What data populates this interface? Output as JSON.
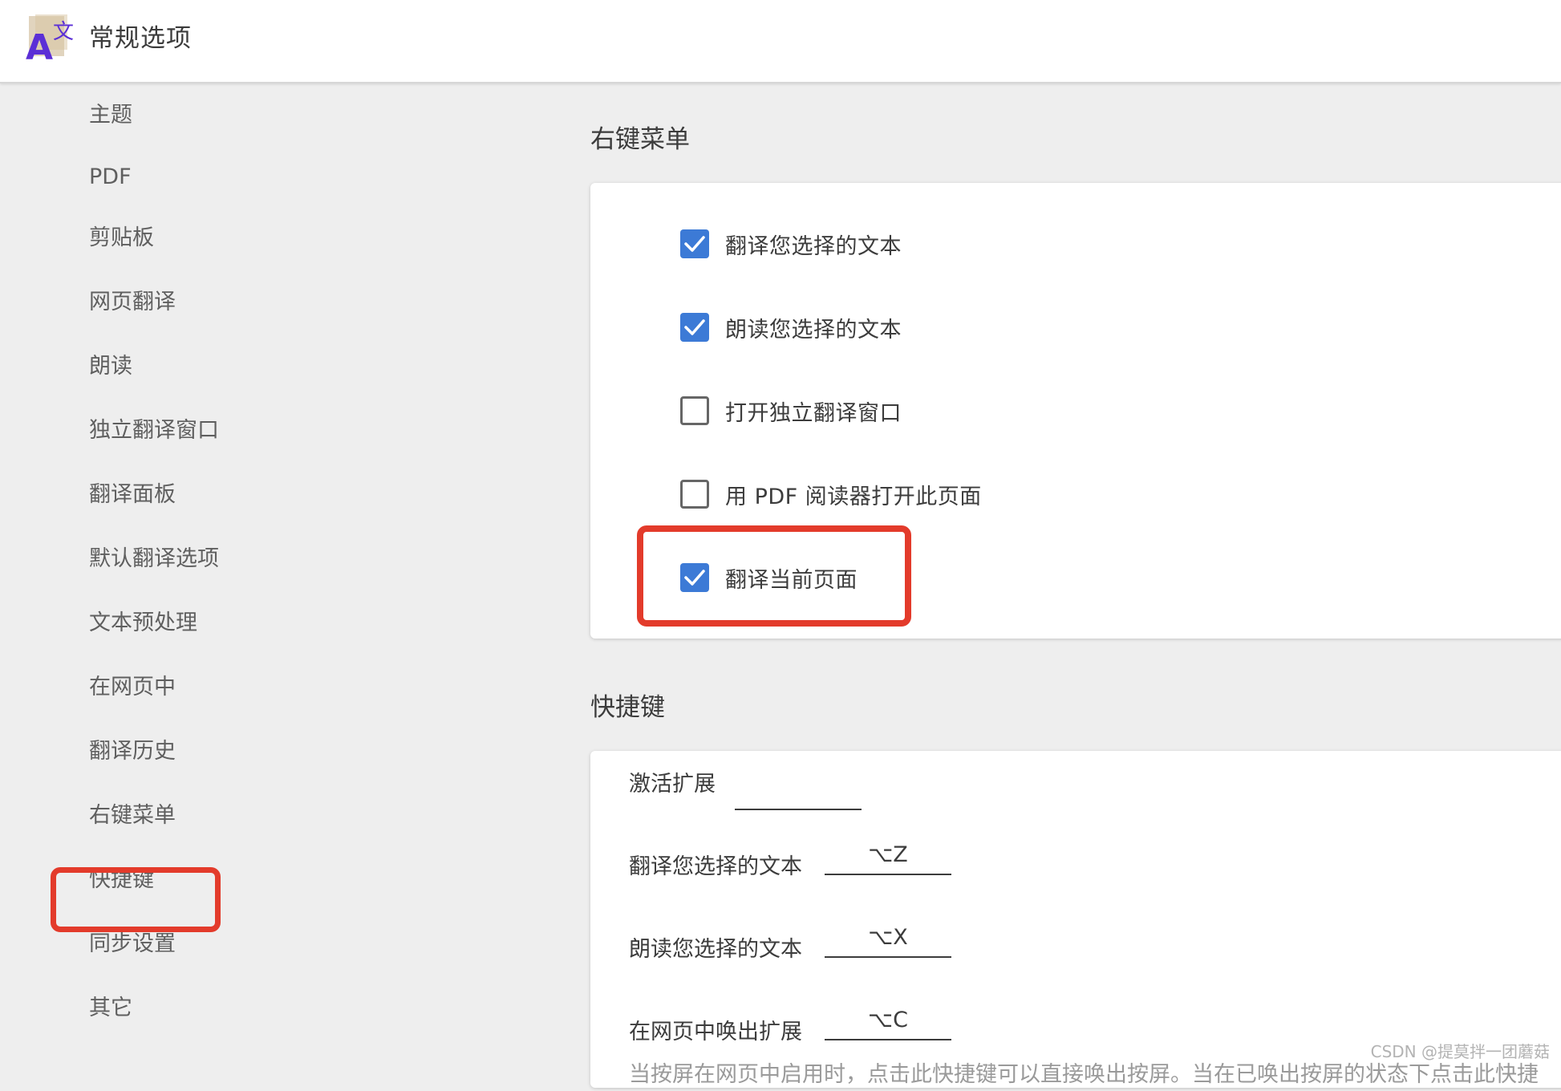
{
  "header": {
    "title": "常规选项",
    "logo_icon": "translate-logo-icon"
  },
  "sidebar": {
    "items": [
      {
        "label": "主题"
      },
      {
        "label": "PDF"
      },
      {
        "label": "剪贴板"
      },
      {
        "label": "网页翻译"
      },
      {
        "label": "朗读"
      },
      {
        "label": "独立翻译窗口"
      },
      {
        "label": "翻译面板"
      },
      {
        "label": "默认翻译选项"
      },
      {
        "label": "文本预处理"
      },
      {
        "label": "在网页中"
      },
      {
        "label": "翻译历史"
      },
      {
        "label": "右键菜单"
      },
      {
        "label": "快捷键"
      },
      {
        "label": "同步设置"
      },
      {
        "label": "其它"
      }
    ],
    "highlighted": "右键菜单"
  },
  "context_menu": {
    "title": "右键菜单",
    "options": [
      {
        "label": "翻译您选择的文本",
        "checked": true
      },
      {
        "label": "朗读您选择的文本",
        "checked": true
      },
      {
        "label": "打开独立翻译窗口",
        "checked": false
      },
      {
        "label": "用 PDF 阅读器打开此页面",
        "checked": false
      },
      {
        "label": "翻译当前页面",
        "checked": true
      }
    ]
  },
  "shortcuts": {
    "title": "快捷键",
    "items": [
      {
        "label": "激活扩展",
        "value": ""
      },
      {
        "label": "翻译您选择的文本",
        "value": "⌥Z"
      },
      {
        "label": "朗读您选择的文本",
        "value": "⌥X"
      },
      {
        "label": "在网页中唤出扩展",
        "value": "⌥C"
      }
    ],
    "cut_off_text": "当按屏在网页中启用时，点击此快捷键可以直接唤出按屏。当在已唤出按屏的状态下点击此快捷"
  },
  "colors": {
    "accent": "#3c7ad6",
    "highlight": "#e33b2b"
  },
  "watermark": "CSDN @提莫拌一团蘑菇"
}
